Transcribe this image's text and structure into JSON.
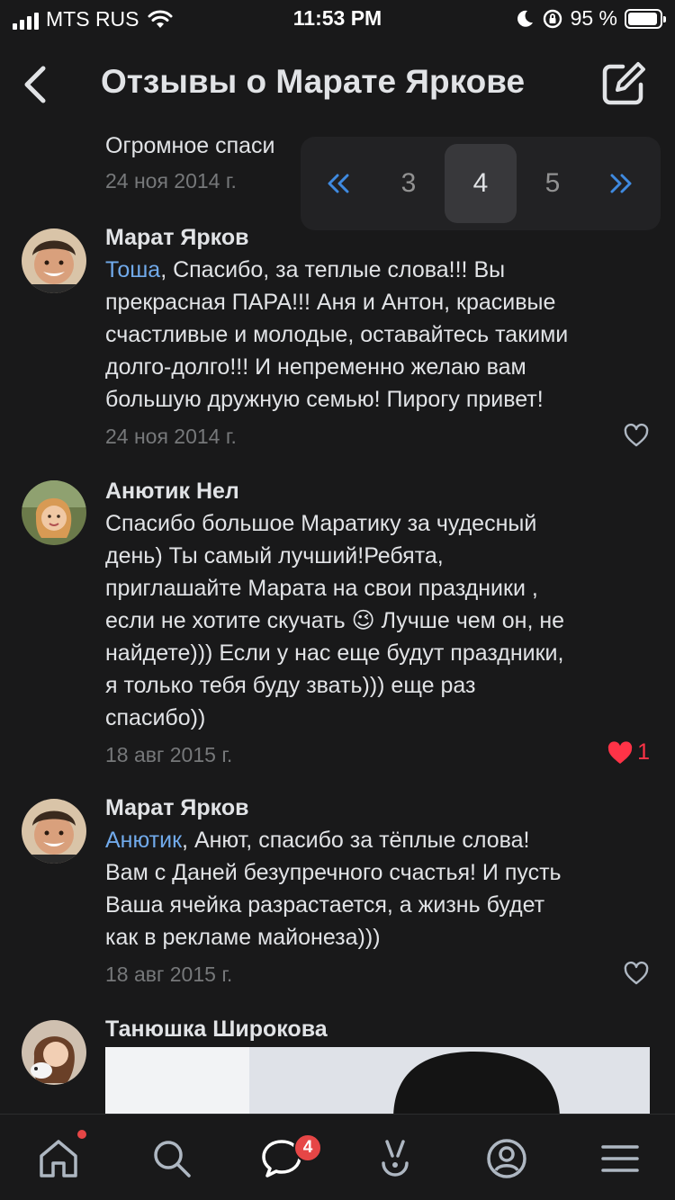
{
  "status_bar": {
    "carrier": "MTS RUS",
    "time": "11:53 PM",
    "battery": "95 %",
    "battery_level": 0.95
  },
  "header": {
    "title": "Отзывы о Марате Яркове"
  },
  "pagination": {
    "pages": [
      "3",
      "4",
      "5"
    ],
    "current": "4"
  },
  "truncated_post": {
    "text": "Огромное спаси",
    "date": "24 ноя 2014 г."
  },
  "posts": [
    {
      "author": "Марат Ярков",
      "mention": "Тоша",
      "lines": [
        ", Спасибо, за теплые слова!!! Вы",
        "прекрасная ПАРА!!! Аня и Антон, красивые",
        "счастливые и молодые, оставайтесь такими",
        "долго-долго!!! И непременно желаю вам",
        "большую дружную семью! Пирогу привет!"
      ],
      "date": "24 ноя 2014 г.",
      "likes": ""
    },
    {
      "author": "Анютик Нел",
      "lines": [
        "Спасибо большое Маратику за чудесный",
        "день) Ты самый лучший!Ребята,",
        "приглашайте Марата на свои праздники ,",
        "если не хотите скучать 😉 Лучше чем он, не",
        "найдете))) Если у нас еще будут праздники,",
        "я только тебя буду звать))) еще раз",
        "спасибо))"
      ],
      "date": "18 авг 2015 г.",
      "likes": "1"
    },
    {
      "author": "Марат Ярков",
      "mention": "Анютик",
      "lines": [
        ", Анют, спасибо за тёплые слова!",
        "Вам с Даней безупречного счастья! И пусть",
        "Ваша ячейка разрастается, а жизнь будет",
        "как в рекламе майонеза)))"
      ],
      "date": "18 авг 2015 г.",
      "likes": ""
    },
    {
      "author": "Танюшка Широкова"
    }
  ],
  "tabbar": {
    "messages_badge": "4"
  },
  "colors": {
    "background": "#19191a",
    "accent": "#71aaeb",
    "like": "#ff3347",
    "secondary": "#76787a"
  }
}
